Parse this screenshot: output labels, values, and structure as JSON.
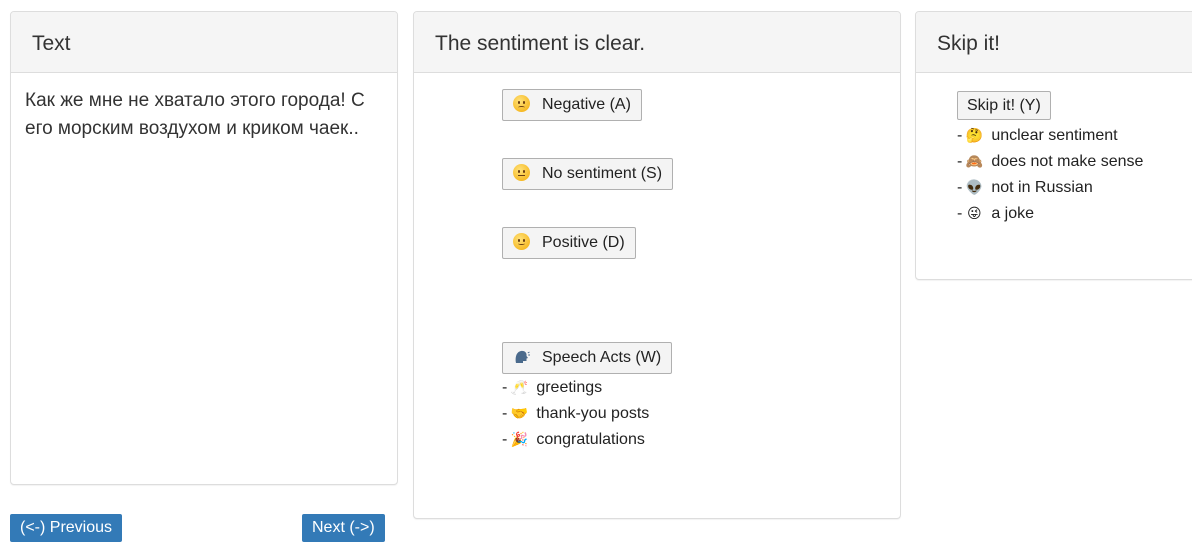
{
  "text_panel": {
    "heading": "Text",
    "body": "Как же мне не хватало этого города! С его морским воздухом и криком чаек.."
  },
  "sentiment_panel": {
    "heading": "The sentiment is clear.",
    "buttons": [
      {
        "label": "Negative (A)",
        "icon": "worried-face-icon"
      },
      {
        "label": "No sentiment (S)",
        "icon": "neutral-face-icon"
      },
      {
        "label": "Positive (D)",
        "icon": "smiling-face-icon"
      }
    ],
    "speech_acts": {
      "label": "Speech Acts (W)",
      "icon": "speaking-head-icon",
      "items": [
        {
          "text": "greetings",
          "icon": "clinking-glasses-icon",
          "glyph": "🥂"
        },
        {
          "text": "thank-you posts",
          "icon": "handshake-icon",
          "glyph": "🤝"
        },
        {
          "text": "congratulations",
          "icon": "party-popper-icon",
          "glyph": "🎉"
        }
      ]
    }
  },
  "skip_panel": {
    "heading": "Skip it!",
    "button_label": "Skip it! (Y)",
    "items": [
      {
        "text": "unclear sentiment",
        "icon": "thinking-face-icon",
        "glyph": "🤔"
      },
      {
        "text": "does not make sense",
        "icon": "see-no-evil-monkey-icon",
        "glyph": "🙈"
      },
      {
        "text": "not in Russian",
        "icon": "alien-icon",
        "glyph": "👽"
      },
      {
        "text": "a joke",
        "icon": "winking-tongue-face-icon",
        "glyph": "😜"
      }
    ]
  },
  "navigation": {
    "previous_label": "(<-) Previous",
    "next_label": "Next (->)"
  },
  "colors": {
    "nav_button": "#337ab7",
    "panel_heading_bg": "#f5f5f5",
    "panel_border": "#dddddd"
  }
}
